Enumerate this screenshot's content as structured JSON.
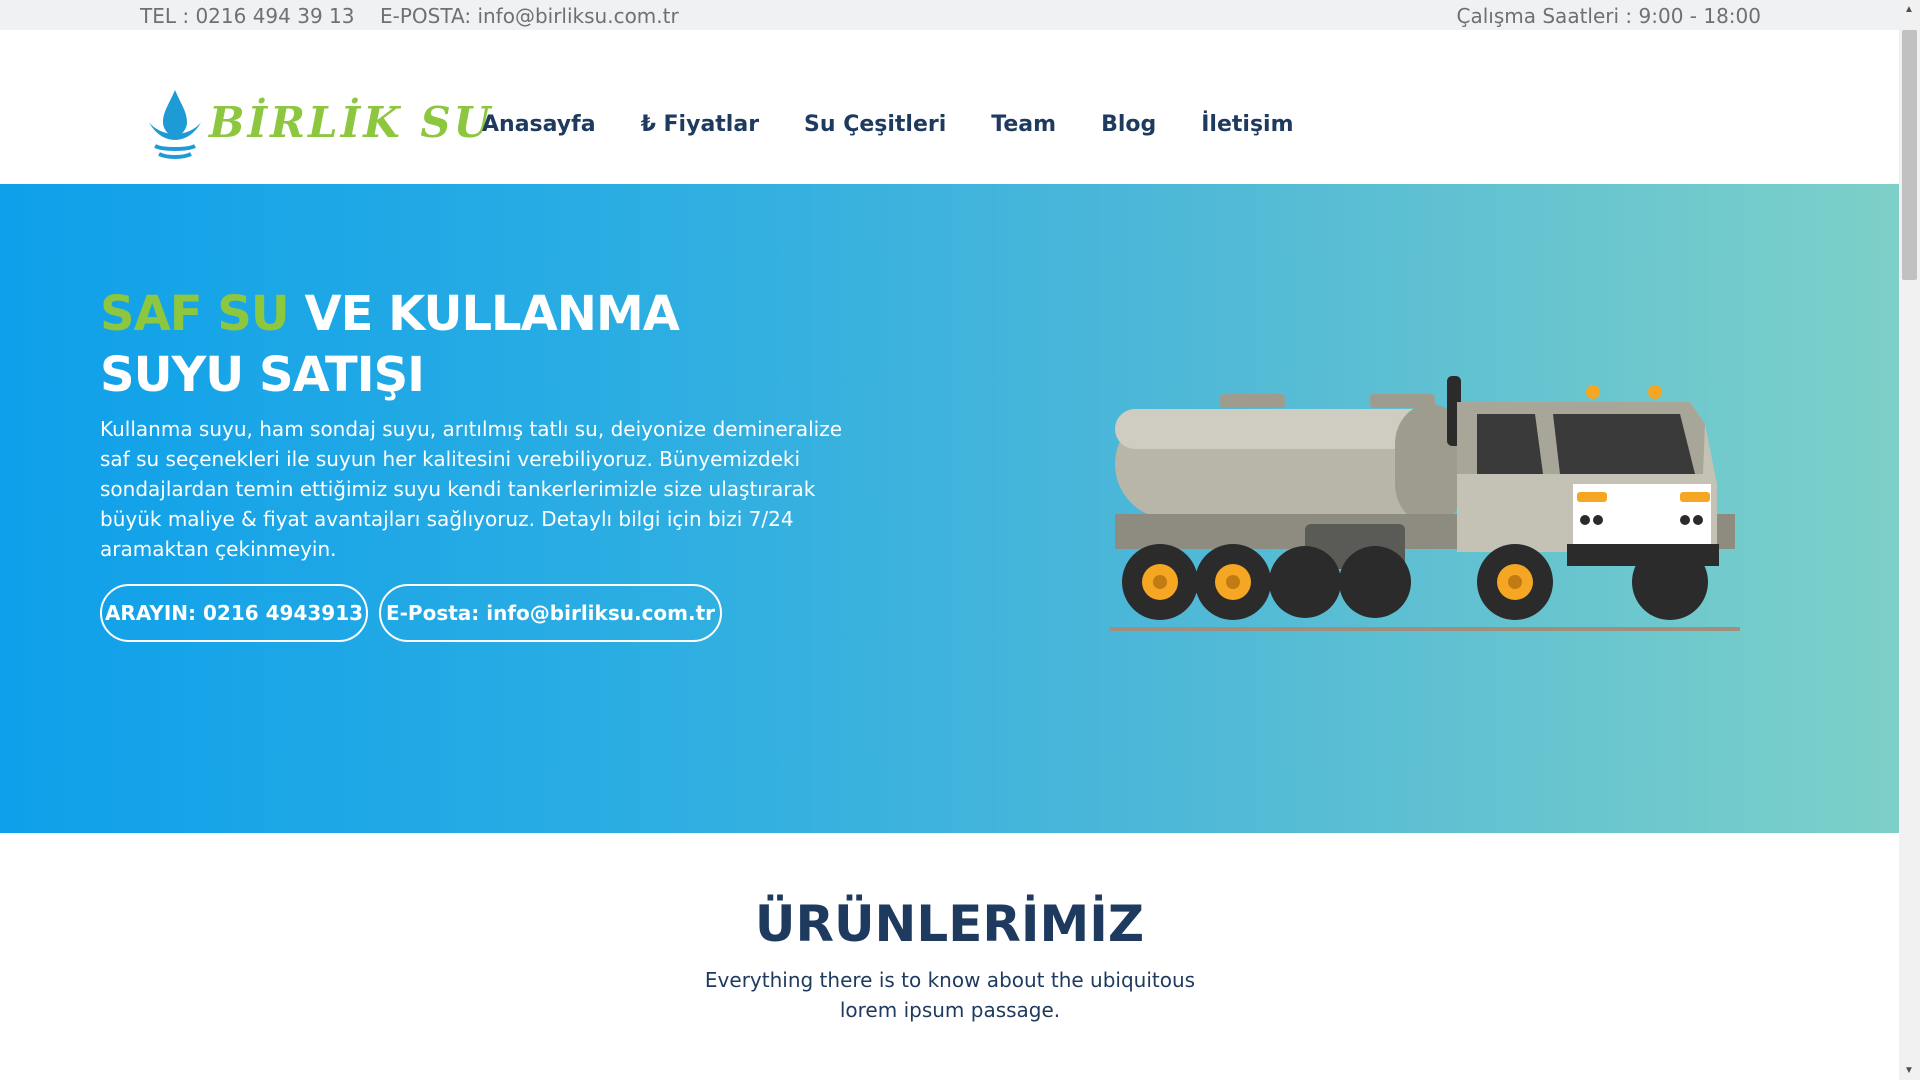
{
  "topbar": {
    "phone": "TEL : 0216 494 39 13",
    "email": "E-POSTA: info@birliksu.com.tr",
    "hours": "Çalışma Saatleri : 9:00 - 18:00"
  },
  "logo": {
    "text": "BİRLİK SU"
  },
  "nav": {
    "home": "Anasayfa",
    "prices": "₺ Fiyatlar",
    "water_types": "Su Çeşitleri",
    "team": "Team",
    "blog": "Blog",
    "contact": "İletişim"
  },
  "hero": {
    "title_accent": "SAF SU",
    "title_rest": " VE KULLANMA",
    "title_line2": "SUYU SATIŞI",
    "description": "Kullanma suyu, ham sondaj suyu, arıtılmış tatlı su, deiyonize demineralize saf su seçenekleri ile suyun her kalitesini verebiliyoruz. Bünyemizdeki sondajlardan temin ettiğimiz suyu kendi tankerlerimizle size ulaştırarak büyük maliye & fiyat avantajları sağlıyoruz. Detaylı bilgi için bizi 7/24 aramaktan çekinmeyin.",
    "call_button": "ARAYIN: 0216 4943913",
    "email_button": "E-Posta: info@birliksu.com.tr"
  },
  "products": {
    "title": "ÜRÜNLERİMİZ",
    "subtitle": "Everything there is to know about the ubiquitous lorem ipsum passage."
  },
  "colors": {
    "brand_green": "#8dc63f",
    "nav_text": "#1e3a5f",
    "hero_gradient_start": "#0ea0ea",
    "hero_gradient_end": "#7dd0c8"
  }
}
